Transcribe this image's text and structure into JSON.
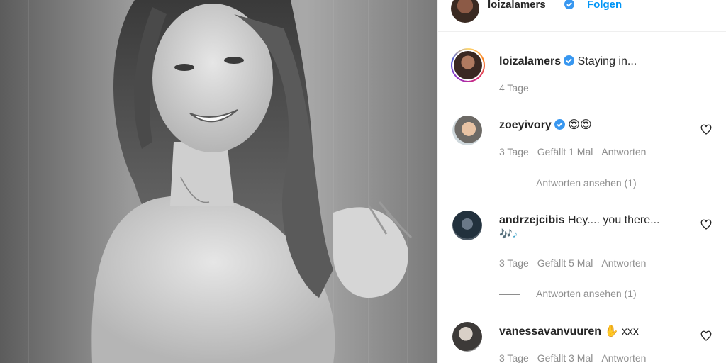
{
  "header": {
    "username": "loizalamers",
    "follow_label": "Folgen"
  },
  "caption": {
    "username": "loizalamers",
    "text": "Staying in...",
    "time": "4 Tage"
  },
  "comments": [
    {
      "username": "zoeyivory",
      "verified": true,
      "text": "😍😍",
      "time": "3 Tage",
      "likes": "Gefällt 1 Mal",
      "reply": "Antworten",
      "view_replies": "Antworten ansehen (1)"
    },
    {
      "username": "andrzejcibis",
      "verified": false,
      "text": "Hey.... you there...",
      "text_line2": "🎶♪",
      "time": "3 Tage",
      "likes": "Gefällt 5 Mal",
      "reply": "Antworten",
      "view_replies": "Antworten ansehen (1)"
    },
    {
      "username": "vanessavanvuuren",
      "verified": false,
      "text": "✋ xxx",
      "time": "3 Tage",
      "likes": "Gefällt 3 Mal",
      "reply": "Antworten"
    }
  ],
  "icons": {
    "verified": "verified-badge-icon",
    "like": "heart-icon"
  },
  "colors": {
    "link_blue": "#0095f6",
    "verified_blue": "#3897f0",
    "secondary_text": "#8e8e8e"
  }
}
